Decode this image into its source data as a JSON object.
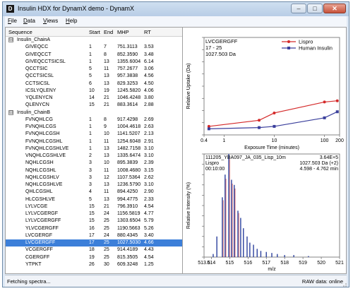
{
  "window": {
    "title": "Insulin HDX for DynamX demo - DynamX",
    "app_icon_letter": "D",
    "controls": {
      "minimize": "–",
      "maximize": "□",
      "close": "✕"
    }
  },
  "menu": [
    {
      "accel": "F",
      "rest": "ile"
    },
    {
      "accel": "D",
      "rest": "ata"
    },
    {
      "accel": "V",
      "rest": "iews"
    },
    {
      "accel": "H",
      "rest": "elp"
    }
  ],
  "table": {
    "columns": [
      "Sequence",
      "Start",
      "End",
      "MHP",
      "RT"
    ],
    "groups": [
      {
        "name": "Insulin_ChainA",
        "expander": "⊟",
        "rows": [
          [
            "GIVEQCC",
            "1",
            "7",
            "751.3113",
            "3.53"
          ],
          [
            "GIVEQCCT",
            "1",
            "8",
            "852.3590",
            "3.48"
          ],
          [
            "GIVEQCCTSICSL",
            "1",
            "13",
            "1355.6004",
            "6.14"
          ],
          [
            "QCCTSIC",
            "5",
            "11",
            "757.2677",
            "3.06"
          ],
          [
            "QCCTSICSL",
            "5",
            "13",
            "957.3838",
            "4.56"
          ],
          [
            "CCTSICSL",
            "6",
            "13",
            "829.3253",
            "4.50"
          ],
          [
            "ICSLYQLENY",
            "10",
            "19",
            "1245.5820",
            "4.06"
          ],
          [
            "YQLENYCN",
            "14",
            "21",
            "1046.4248",
            "3.80"
          ],
          [
            "QLENYCN",
            "15",
            "21",
            "883.3614",
            "2.88"
          ]
        ]
      },
      {
        "name": "Insulin_ChainB",
        "expander": "⊟",
        "rows": [
          [
            "FVNQHLCG",
            "1",
            "8",
            "917.4298",
            "2.69"
          ],
          [
            "FVNQHLCGS",
            "1",
            "9",
            "1004.4618",
            "2.63"
          ],
          [
            "FVNQHLCGSH",
            "1",
            "10",
            "1141.5207",
            "2.13"
          ],
          [
            "FVNQHLCGSHL",
            "1",
            "11",
            "1254.6048",
            "2.91"
          ],
          [
            "FVNQHLCGSHLVE",
            "1",
            "13",
            "1482.7158",
            "3.10"
          ],
          [
            "VNQHLCGSHLVE",
            "2",
            "13",
            "1335.6474",
            "3.10"
          ],
          [
            "NQHLCGSH",
            "3",
            "10",
            "895.3839",
            "2.39"
          ],
          [
            "NQHLCGSHL",
            "3",
            "11",
            "1008.4680",
            "3.15"
          ],
          [
            "NQHLCGSHLV",
            "3",
            "12",
            "1107.5364",
            "2.62"
          ],
          [
            "NQHLCGSHLVE",
            "3",
            "13",
            "1236.5790",
            "3.10"
          ],
          [
            "QHLCGSHL",
            "4",
            "11",
            "894.4250",
            "2.90"
          ],
          [
            "HLCGSHLVE",
            "5",
            "13",
            "994.4775",
            "2.33"
          ],
          [
            "LYLVCGE",
            "15",
            "21",
            "796.3910",
            "4.54"
          ],
          [
            "LYLVCGERGF",
            "15",
            "24",
            "1156.5819",
            "4.77"
          ],
          [
            "LYLVCGERGFF",
            "15",
            "25",
            "1303.6504",
            "5.79"
          ],
          [
            "YLVCGERGFF",
            "16",
            "25",
            "1190.5663",
            "5.26"
          ],
          [
            "LVCGERGF",
            "17",
            "24",
            "880.4345",
            "3.40"
          ],
          [
            "LVCGERGFF",
            "17",
            "25",
            "1027.5030",
            "4.66"
          ],
          [
            "VCGERGFF",
            "18",
            "25",
            "914.4189",
            "4.43"
          ],
          [
            "CGERGFF",
            "19",
            "25",
            "815.3505",
            "4.54"
          ],
          [
            "YTPKT",
            "26",
            "30",
            "609.3248",
            "1.25"
          ]
        ]
      }
    ],
    "selected_sequence": "LVCGERGFF"
  },
  "uptake_chart": {
    "header_lines": [
      "LVCGERGFF",
      "17 - 25",
      "1027.503 Da"
    ],
    "ylabel": "Relative Uptake (Da)",
    "xlabel": "Exposure Time (minutes)",
    "x_ticks": [
      "0.4",
      "1",
      "10",
      "100",
      "200"
    ],
    "y_ticks": [
      "0",
      "1",
      "2",
      "3",
      "4",
      "5",
      "6",
      "7",
      "8"
    ],
    "colors": {
      "Lispro": "#d42a2a",
      "Human Insulin": "#3a3f9c"
    }
  },
  "spectrum_chart": {
    "header_left": [
      "111205_YBA097_JA_035_Lisp_10m",
      "Lispro",
      "00:10:00"
    ],
    "header_right": [
      "3.64E+5",
      "1027.503 Da (+2)",
      "4.598 - 4.762 min"
    ],
    "xlabel": "m/z",
    "ylabel": "Relative Intensity (%)",
    "x_ticks": [
      "513.6",
      "514",
      "515",
      "516",
      "517",
      "518",
      "519",
      "520",
      "521"
    ],
    "y_ticks": [
      "0",
      "10",
      "20",
      "30",
      "40",
      "50",
      "60",
      "70",
      "80",
      "90",
      "100"
    ],
    "colors": {
      "peaks": "#2b3f9c",
      "markers": "#d42a2a"
    }
  },
  "chart_data": [
    {
      "type": "line",
      "xscale": "log",
      "xlim": [
        0.4,
        200
      ],
      "ylim": [
        0,
        8
      ],
      "xlabel": "Exposure Time (minutes)",
      "ylabel": "Relative Uptake (Da)",
      "legend_position": "top-right",
      "series": [
        {
          "name": "Lispro",
          "x": [
            0.5,
            5,
            10,
            100,
            180
          ],
          "y": [
            0.7,
            1.2,
            1.8,
            2.7,
            2.8
          ]
        },
        {
          "name": "Human Insulin",
          "x": [
            0.5,
            5,
            10,
            100,
            180
          ],
          "y": [
            0.5,
            0.6,
            0.7,
            1.4,
            1.9
          ]
        }
      ]
    },
    {
      "type": "bar",
      "xlim": [
        513.6,
        521
      ],
      "ylim": [
        0,
        100
      ],
      "xlabel": "m/z",
      "ylabel": "Relative Intensity (%)",
      "series": [
        {
          "name": "Lispro",
          "x": [
            514.1,
            514.3,
            514.6,
            514.75,
            514.95,
            515.1,
            515.25,
            515.45,
            515.6,
            515.75,
            515.95,
            516.1,
            516.3,
            516.5,
            516.7,
            517.0,
            517.3,
            517.6,
            518.0,
            518.5,
            519.3
          ],
          "y": [
            3,
            20,
            58,
            80,
            100,
            75,
            70,
            45,
            38,
            28,
            20,
            14,
            12,
            8,
            6,
            5,
            4,
            3,
            2,
            2,
            1
          ]
        }
      ]
    }
  ],
  "status": {
    "left": "Fetching spectra...",
    "right": "RAW data: online"
  }
}
